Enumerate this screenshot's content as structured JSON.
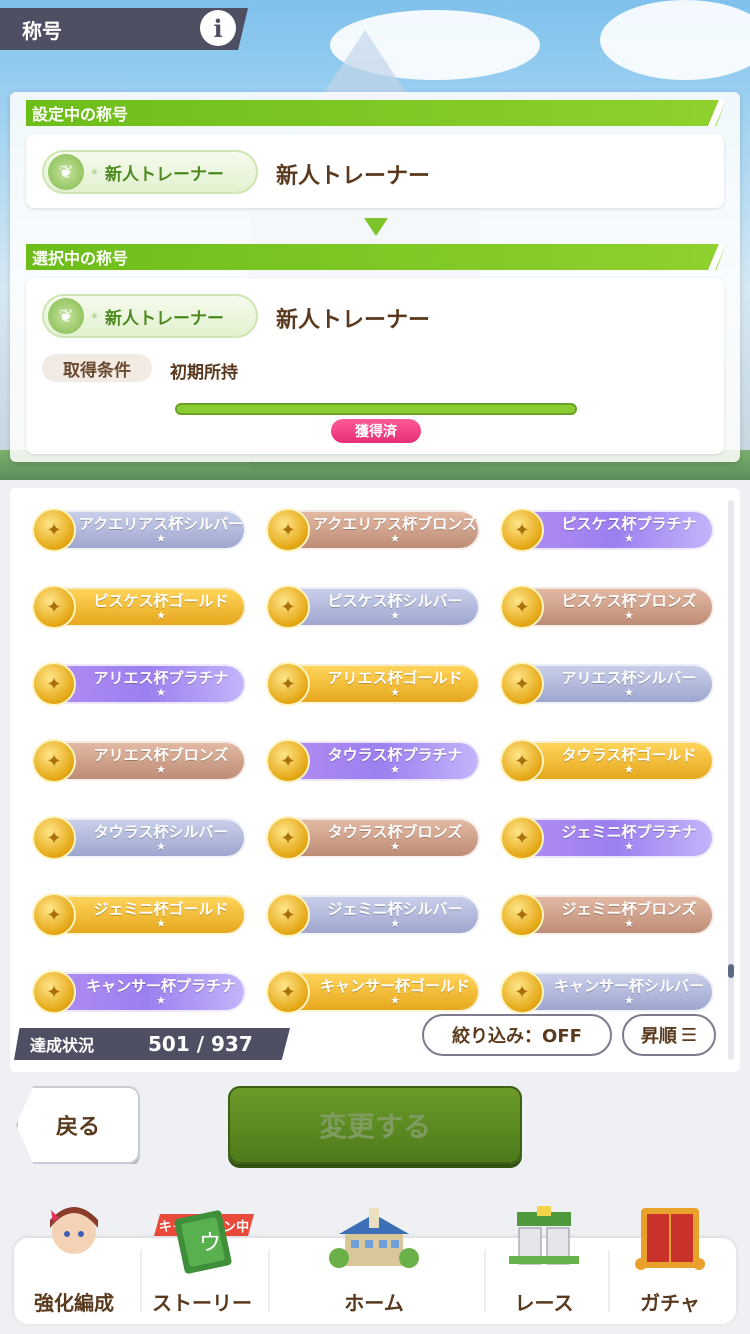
{
  "header": {
    "title": "称号",
    "info_label": "i"
  },
  "current_section": {
    "header": "設定中の称号",
    "title_badge": "新人トレーナー",
    "title_name": "新人トレーナー"
  },
  "selected_section": {
    "header": "選択中の称号",
    "title_badge": "新人トレーナー",
    "title_name": "新人トレーナー",
    "condition_label": "取得条件",
    "condition_value": "初期所持",
    "progress": 1.0,
    "status": "獲得済"
  },
  "titles": [
    {
      "label": "アクエリアス杯シルバー",
      "tier": "silver"
    },
    {
      "label": "アクエリアス杯ブロンズ",
      "tier": "bronze"
    },
    {
      "label": "ピスケス杯プラチナ",
      "tier": "platinum"
    },
    {
      "label": "ピスケス杯ゴールド",
      "tier": "gold"
    },
    {
      "label": "ピスケス杯シルバー",
      "tier": "silver"
    },
    {
      "label": "ピスケス杯ブロンズ",
      "tier": "bronze"
    },
    {
      "label": "アリエス杯プラチナ",
      "tier": "platinum"
    },
    {
      "label": "アリエス杯ゴールド",
      "tier": "gold"
    },
    {
      "label": "アリエス杯シルバー",
      "tier": "silver"
    },
    {
      "label": "アリエス杯ブロンズ",
      "tier": "bronze"
    },
    {
      "label": "タウラス杯プラチナ",
      "tier": "platinum"
    },
    {
      "label": "タウラス杯ゴールド",
      "tier": "gold"
    },
    {
      "label": "タウラス杯シルバー",
      "tier": "silver"
    },
    {
      "label": "タウラス杯ブロンズ",
      "tier": "bronze"
    },
    {
      "label": "ジェミニ杯プラチナ",
      "tier": "platinum"
    },
    {
      "label": "ジェミニ杯ゴールド",
      "tier": "gold"
    },
    {
      "label": "ジェミニ杯シルバー",
      "tier": "silver"
    },
    {
      "label": "ジェミニ杯ブロンズ",
      "tier": "bronze"
    },
    {
      "label": "キャンサー杯プラチナ",
      "tier": "platinum"
    },
    {
      "label": "キャンサー杯ゴールド",
      "tier": "gold"
    },
    {
      "label": "キャンサー杯シルバー",
      "tier": "silver"
    }
  ],
  "star_glyph": "★",
  "achievement": {
    "label": "達成状況",
    "value": "501 / 937"
  },
  "filter_label": "絞り込み：OFF",
  "sort_label": "昇順",
  "buttons": {
    "back": "戻る",
    "change": "変更する"
  },
  "nav": {
    "campaign": "キャンペーン中",
    "items": [
      "強化編成",
      "ストーリー",
      "ホーム",
      "レース",
      "ガチャ"
    ]
  },
  "colors": {
    "accent_green": "#7cc42a",
    "pink": "#e72f76",
    "dark_tag": "#4f4f63"
  }
}
